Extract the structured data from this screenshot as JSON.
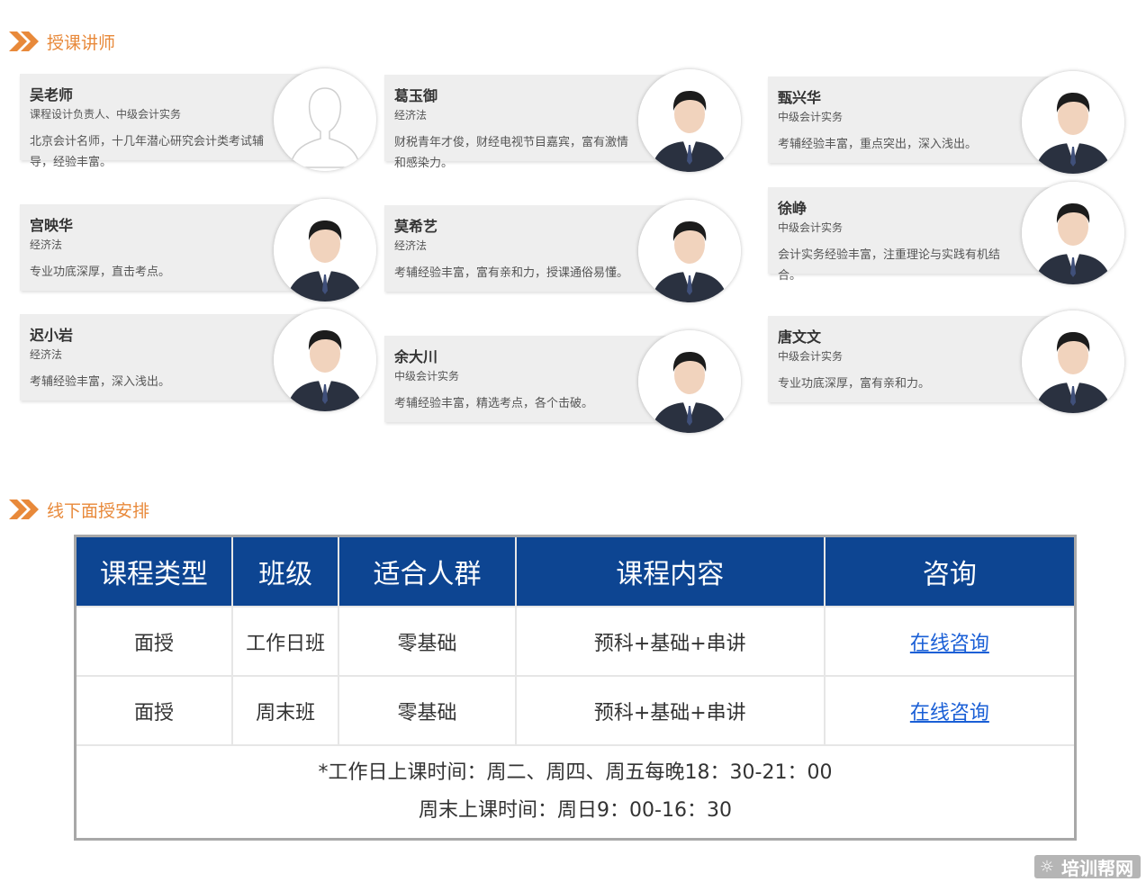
{
  "sections": {
    "teachers_title": "授课讲师",
    "offline_title": "线下面授安排"
  },
  "teachers": [
    {
      "name": "吴老师",
      "subject": "课程设计负责人、中级会计实务",
      "desc": "北京会计名师，十几年潜心研究会计类考试辅导，经验丰富。",
      "photo": "placeholder-silhouette"
    },
    {
      "name": "葛玉御",
      "subject": "经济法",
      "desc": "财税青年才俊，财经电视节目嘉宾，富有激情和感染力。",
      "photo": "teacher-photo"
    },
    {
      "name": "甄兴华",
      "subject": "中级会计实务",
      "desc": "考辅经验丰富，重点突出，深入浅出。",
      "photo": "teacher-photo"
    },
    {
      "name": "宫映华",
      "subject": "经济法",
      "desc": "专业功底深厚，直击考点。",
      "photo": "teacher-photo"
    },
    {
      "name": "莫希艺",
      "subject": "经济法",
      "desc": "考辅经验丰富，富有亲和力，授课通俗易懂。",
      "photo": "teacher-photo"
    },
    {
      "name": "徐峥",
      "subject": "中级会计实务",
      "desc": "会计实务经验丰富，注重理论与实践有机结合。",
      "photo": "teacher-photo"
    },
    {
      "name": "迟小岩",
      "subject": "经济法",
      "desc": "考辅经验丰富，深入浅出。",
      "photo": "teacher-photo"
    },
    {
      "name": "余大川",
      "subject": "中级会计实务",
      "desc": "考辅经验丰富，精选考点，各个击破。",
      "photo": "teacher-photo"
    },
    {
      "name": "唐文文",
      "subject": "中级会计实务",
      "desc": "专业功底深厚，富有亲和力。",
      "photo": "teacher-photo"
    }
  ],
  "schedule": {
    "headers": [
      "课程类型",
      "班级",
      "适合人群",
      "课程内容",
      "咨询"
    ],
    "rows": [
      [
        "面授",
        "工作日班",
        "零基础",
        "预科+基础+串讲",
        "在线咨询"
      ],
      [
        "面授",
        "周末班",
        "零基础",
        "预科+基础+串讲",
        "在线咨询"
      ]
    ],
    "note_line1": "*工作日上课时间：周二、周四、周五每晚18：30-21：00",
    "note_line2": "周末上课时间：周日9：00-16：30"
  },
  "watermark": {
    "text": "培训帮网",
    "icon": "sun-logo-icon"
  },
  "colors": {
    "accent": "#e8893a",
    "header_bg": "#0d4592",
    "link": "#1a5fd6"
  }
}
